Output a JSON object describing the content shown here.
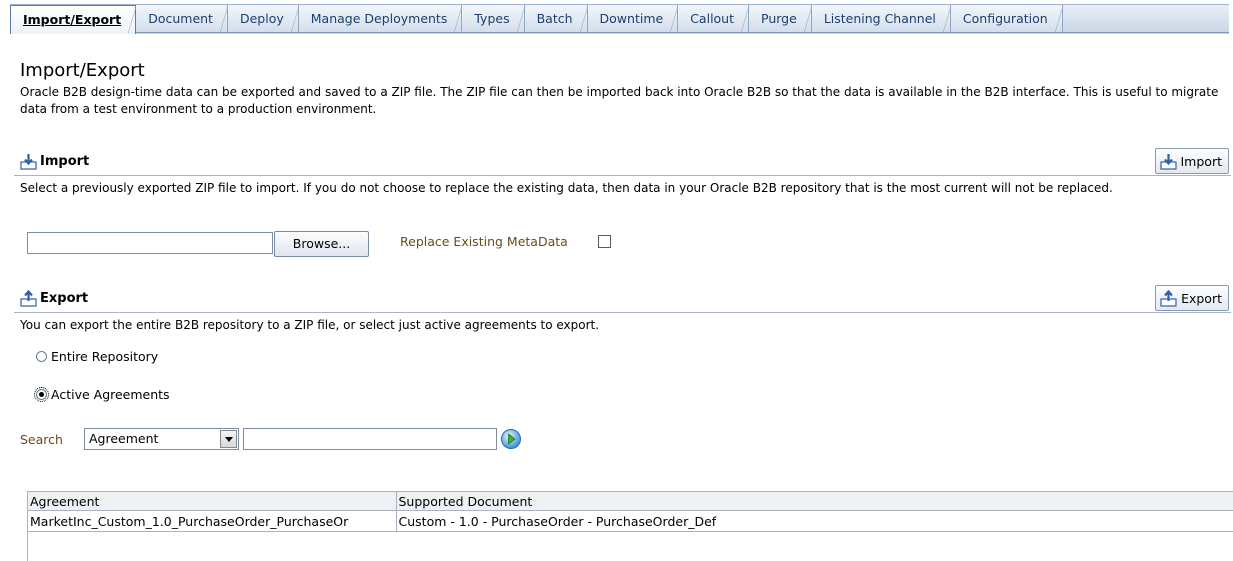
{
  "tabs": [
    {
      "label": "Import/Export",
      "active": true
    },
    {
      "label": "Document"
    },
    {
      "label": "Deploy"
    },
    {
      "label": "Manage Deployments"
    },
    {
      "label": "Types"
    },
    {
      "label": "Batch"
    },
    {
      "label": "Downtime"
    },
    {
      "label": "Callout"
    },
    {
      "label": "Purge"
    },
    {
      "label": "Listening Channel"
    },
    {
      "label": "Configuration"
    }
  ],
  "page": {
    "title": "Import/Export",
    "intro": "Oracle B2B design-time data can be exported and saved to a ZIP file. The ZIP file can then be imported back into Oracle B2B so that the data is available in the B2B interface. This is useful to migrate data from a test environment to a production environment."
  },
  "import": {
    "heading": "Import",
    "button": "Import",
    "description": "Select a previously exported ZIP file to import. If you do not choose to replace the existing data, then data in your Oracle B2B repository that is the most current will not be replaced.",
    "file_value": "",
    "browse": "Browse...",
    "replace_label": "Replace Existing MetaData",
    "replace_checked": false
  },
  "export": {
    "heading": "Export",
    "button": "Export",
    "description": "You can export the entire B2B repository to a ZIP file, or select just active agreements to export.",
    "options": [
      {
        "label": "Entire Repository",
        "selected": false
      },
      {
        "label": "Active Agreements",
        "selected": true
      }
    ]
  },
  "search": {
    "label": "Search",
    "field": "Agreement",
    "query": ""
  },
  "table": {
    "columns": [
      "Agreement",
      "Supported Document"
    ],
    "rows": [
      [
        "MarketInc_Custom_1.0_PurchaseOrder_PurchaseOr",
        "Custom - 1.0 - PurchaseOrder - PurchaseOrder_Def"
      ]
    ]
  },
  "colors": {
    "tab_text": "#1d3f6e",
    "label_brown": "#6b4a1c",
    "icon_blue": "#2e5fa8"
  }
}
